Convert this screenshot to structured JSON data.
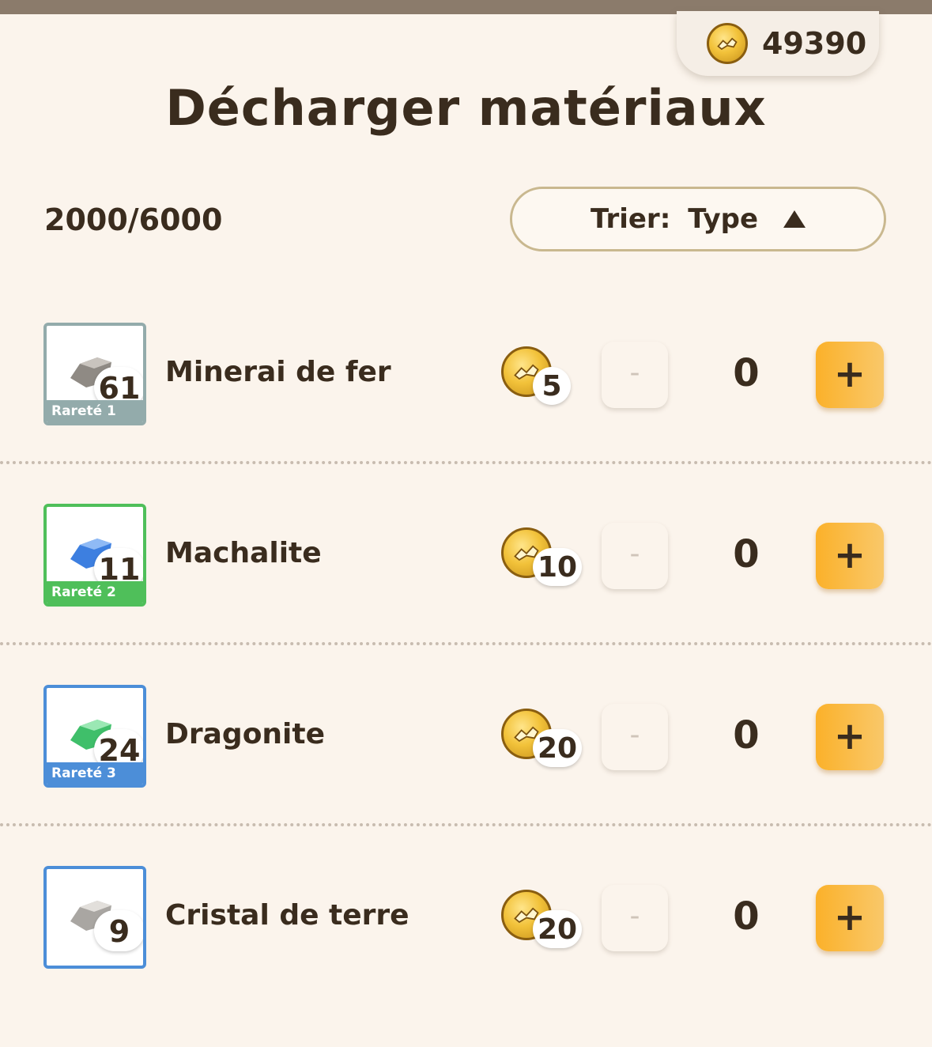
{
  "currency": {
    "icon": "gold-coin-icon",
    "amount": "49390"
  },
  "title": "Décharger matériaux",
  "capacity": "2000/6000",
  "sort": {
    "prefix": "Trier:",
    "value": "Type",
    "direction_icon": "triangle-up-icon"
  },
  "materials": [
    {
      "name": "Minerai de fer",
      "count": "61",
      "rarity": "Rareté 1",
      "price": "5",
      "quantity": "0",
      "minus_label": "-",
      "plus_label": "+",
      "rarity_color": "#93abab",
      "ore_color": "#8f8a84"
    },
    {
      "name": "Machalite",
      "count": "11",
      "rarity": "Rareté 2",
      "price": "10",
      "quantity": "0",
      "minus_label": "-",
      "plus_label": "+",
      "rarity_color": "#4fbf5a",
      "ore_color": "#3d7fe0"
    },
    {
      "name": "Dragonite",
      "count": "24",
      "rarity": "Rareté 3",
      "price": "20",
      "quantity": "0",
      "minus_label": "-",
      "plus_label": "+",
      "rarity_color": "#4c8ed8",
      "ore_color": "#3fbf6a"
    },
    {
      "name": "Cristal de terre",
      "count": "9",
      "rarity": "",
      "price": "20",
      "quantity": "0",
      "minus_label": "-",
      "plus_label": "+",
      "rarity_color": "#4c8ed8",
      "ore_color": "#a9a6a2"
    }
  ]
}
